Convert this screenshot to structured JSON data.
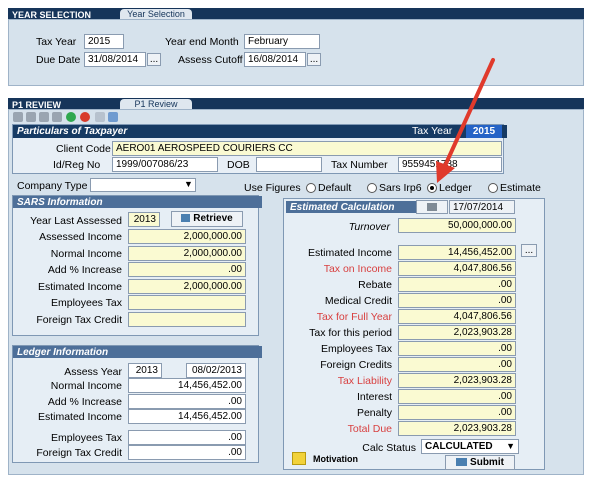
{
  "year_selection": {
    "header": "YEAR SELECTION",
    "tab": "Year Selection",
    "tax_year_label": "Tax Year",
    "tax_year_value": "2015",
    "year_end_month_label": "Year end Month",
    "year_end_month_value": "February",
    "due_date_label": "Due Date",
    "due_date_value": "31/08/2014",
    "assess_cutoff_label": "Assess Cutoff",
    "assess_cutoff_value": "16/08/2014",
    "ellipsis": "..."
  },
  "p1_review": {
    "header": "P1 REVIEW",
    "tab": "P1 Review"
  },
  "particulars": {
    "title": "Particulars of Taxpayer",
    "tax_year_label": "Tax Year",
    "tax_year_value": "2015",
    "client_code_label": "Client Code",
    "client_code_value": "AERO01 AEROSPEED COURIERS CC",
    "id_reg_label": "Id/Reg No",
    "id_reg_value": "1999/007086/23",
    "dob_label": "DOB",
    "dob_value": "",
    "tax_number_label": "Tax Number",
    "tax_number_value": "9559451738"
  },
  "company_type": {
    "label": "Company Type",
    "value": ""
  },
  "use_figures": {
    "label": "Use Figures",
    "options": [
      "Default",
      "Sars Irp6",
      "Ledger",
      "Estimate"
    ],
    "selected": "Ledger"
  },
  "sars_info": {
    "title": "SARS Information",
    "year_last_assessed_label": "Year Last Assessed",
    "year_last_assessed_value": "2013",
    "retrieve_label": "Retrieve",
    "rows": [
      {
        "label": "Assessed Income",
        "value": "2,000,000.00"
      },
      {
        "label": "Normal Income",
        "value": "2,000,000.00"
      },
      {
        "label": "Add % Increase",
        "value": ".00"
      },
      {
        "label": "Estimated Income",
        "value": "2,000,000.00"
      },
      {
        "label": "Employees Tax",
        "value": ""
      },
      {
        "label": "Foreign Tax Credit",
        "value": ""
      }
    ]
  },
  "ledger_info": {
    "title": "Ledger Information",
    "assess_year_label": "Assess Year",
    "assess_year_value": "2013",
    "assess_date_value": "08/02/2013",
    "rows": [
      {
        "label": "Normal Income",
        "value": "14,456,452.00"
      },
      {
        "label": "Add % Increase",
        "value": ".00"
      },
      {
        "label": "Estimated Income",
        "value": "14,456,452.00"
      },
      {
        "label": "Employees Tax",
        "value": ".00"
      },
      {
        "label": "Foreign Tax Credit",
        "value": ".00"
      }
    ]
  },
  "estimated_calc": {
    "title": "Estimated Calculation",
    "date": "17/07/2014",
    "turnover_label": "Turnover",
    "turnover_value": "50,000,000.00",
    "rows": [
      {
        "label": "Estimated Income",
        "value": "14,456,452.00",
        "red": false
      },
      {
        "label": "Tax on Income",
        "value": "4,047,806.56",
        "red": true
      },
      {
        "label": "Rebate",
        "value": ".00",
        "red": false
      },
      {
        "label": "Medical Credit",
        "value": ".00",
        "red": false
      },
      {
        "label": "Tax for Full Year",
        "value": "4,047,806.56",
        "red": true
      },
      {
        "label": "Tax for this period",
        "value": "2,023,903.28",
        "red": false
      },
      {
        "label": "Employees Tax",
        "value": ".00",
        "red": false
      },
      {
        "label": "Foreign Credits",
        "value": ".00",
        "red": false
      },
      {
        "label": "Tax Liability",
        "value": "2,023,903.28",
        "red": true
      },
      {
        "label": "Interest",
        "value": ".00",
        "red": false
      },
      {
        "label": "Penalty",
        "value": ".00",
        "red": false
      },
      {
        "label": "Total Due",
        "value": "2,023,903.28",
        "red": true
      }
    ],
    "calc_status_label": "Calc Status",
    "calc_status_value": "CALCULATED",
    "submit_label": "Submit",
    "motivation_label": "Motivation",
    "ellipsis": "..."
  },
  "colors": {
    "header_bg": "#16355a",
    "panel_bg": "#d6e2ec",
    "field_yellow": "#fafad2",
    "highlight_red": "#d84040",
    "arrow_red": "#e03a2c"
  }
}
